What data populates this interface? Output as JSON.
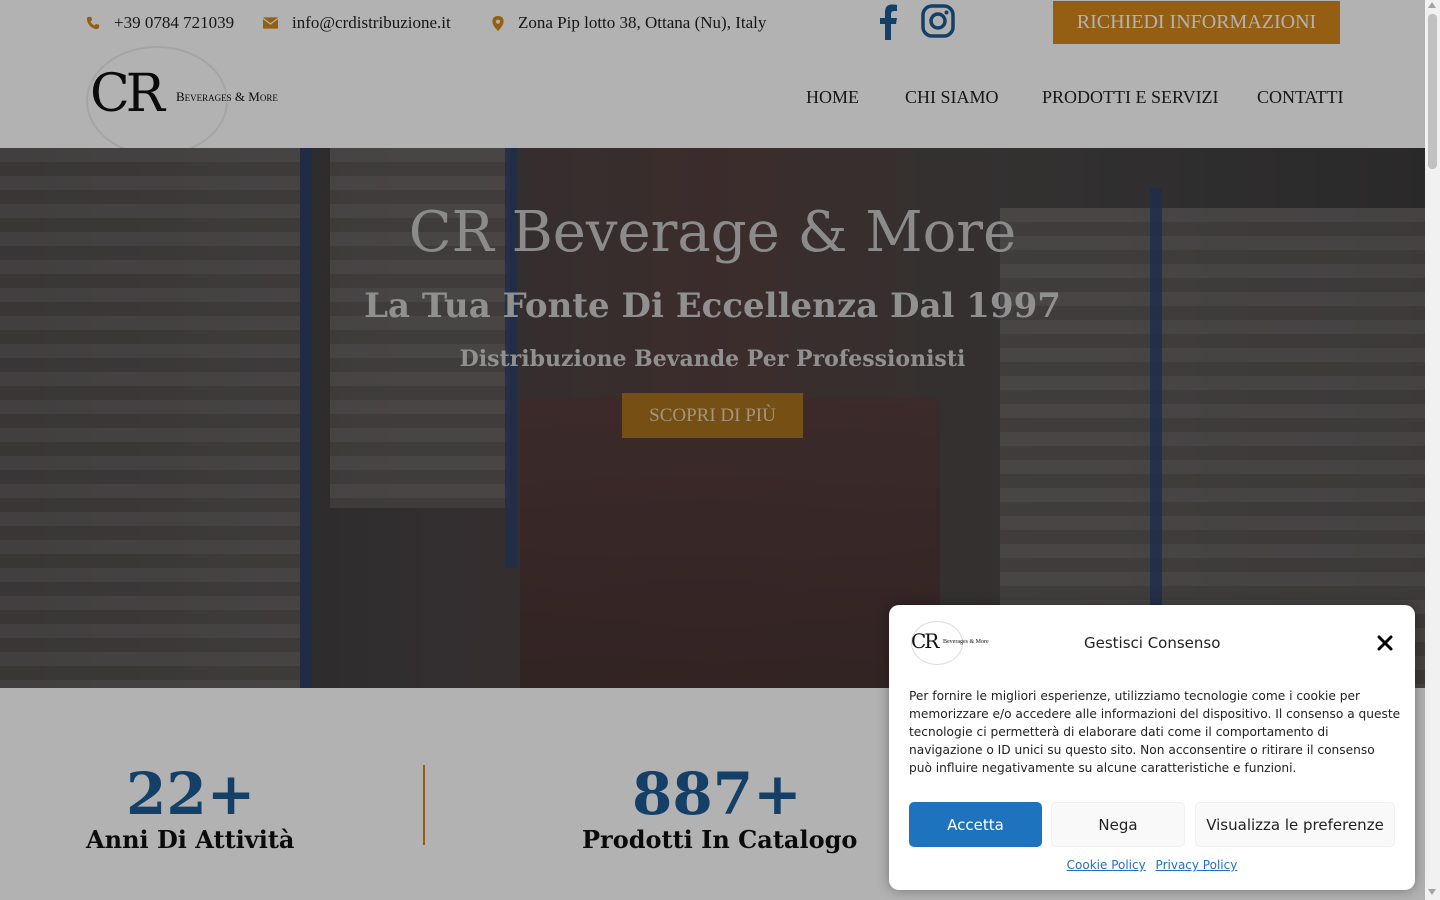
{
  "topbar": {
    "phone": "+39 0784 721039",
    "email": "info@crdistribuzione.it",
    "address": "Zona Pip lotto 38, Ottana (Nu), Italy",
    "cta_label": "RICHIEDI INFORMAZIONI",
    "icons": [
      "phone-icon",
      "envelope-icon",
      "map-marker-icon",
      "facebook-icon",
      "instagram-icon"
    ],
    "accent_color": "#d4881b"
  },
  "header": {
    "logo_main": "CR",
    "logo_sub": "Beverages & More",
    "nav": [
      "HOME",
      "CHI SIAMO",
      "PRODOTTI E SERVIZI",
      "CONTATTI"
    ]
  },
  "hero": {
    "title": "CR Beverage & More",
    "subtitle": "La Tua Fonte Di Eccellenza Dal 1997",
    "tagline": "Distribuzione Bevande Per Professionisti",
    "cta_label": "SCOPRI DI PIÙ"
  },
  "stats": [
    {
      "value": "22+",
      "label": "Anni Di Attività"
    },
    {
      "value": "887+",
      "label": "Prodotti In Catalogo"
    }
  ],
  "cookie": {
    "logo_main": "CR",
    "logo_sub": "Beverages & More",
    "title": "Gestisci Consenso",
    "text": "Per fornire le migliori esperienze, utilizziamo tecnologie come i cookie per memorizzare e/o accedere alle informazioni del dispositivo. Il consenso a queste tecnologie ci permetterà di elaborare dati come il comportamento di navigazione o ID unici su questo sito. Non acconsentire o ritirare il consenso può influire negativamente su alcune caratteristiche e funzioni.",
    "accept_label": "Accetta",
    "deny_label": "Nega",
    "prefs_label": "Visualizza le preferenze",
    "links": [
      "Cookie Policy",
      "Privacy Policy"
    ],
    "accept_color": "#1e73be"
  }
}
